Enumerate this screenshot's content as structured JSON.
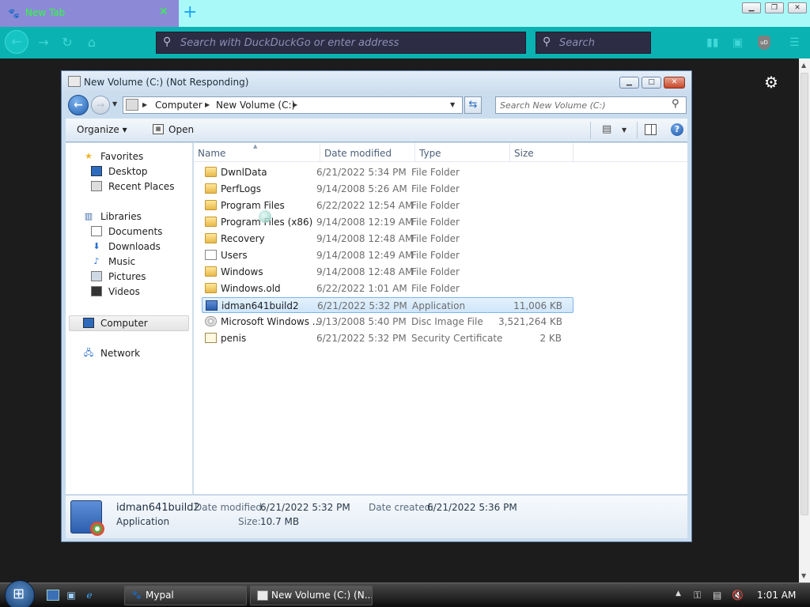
{
  "browser": {
    "tab_title": "New Tab",
    "tab_close": "✕",
    "new_tab": "+",
    "url_placeholder": "Search with DuckDuckGo or enter address",
    "search_placeholder": "Search",
    "ublock_label": "uD"
  },
  "explorer": {
    "title": "New Volume (C:) (Not Responding)",
    "breadcrumbs": [
      "Computer",
      "New Volume (C:)"
    ],
    "search_placeholder": "Search New Volume (C:)",
    "toolbar": {
      "organize": "Organize ▾",
      "open": "Open"
    },
    "nav": {
      "favorites": "Favorites",
      "desktop": "Desktop",
      "recent_places": "Recent Places",
      "libraries": "Libraries",
      "documents": "Documents",
      "downloads": "Downloads",
      "music": "Music",
      "pictures": "Pictures",
      "videos": "Videos",
      "computer": "Computer",
      "network": "Network"
    },
    "columns": {
      "name": "Name",
      "date": "Date modified",
      "type": "Type",
      "size": "Size"
    },
    "files": [
      {
        "name": "DwnlData",
        "date": "6/21/2022 5:34 PM",
        "type": "File Folder",
        "size": "",
        "icon": "folder-icon"
      },
      {
        "name": "PerfLogs",
        "date": "9/14/2008 5:26 AM",
        "type": "File Folder",
        "size": "",
        "icon": "folder-icon"
      },
      {
        "name": "Program Files",
        "date": "6/22/2022 12:54 AM",
        "type": "File Folder",
        "size": "",
        "icon": "folder-icon"
      },
      {
        "name": "Program Files (x86)",
        "date": "9/14/2008 12:19 AM",
        "type": "File Folder",
        "size": "",
        "icon": "folder-icon"
      },
      {
        "name": "Recovery",
        "date": "9/14/2008 12:48 AM",
        "type": "File Folder",
        "size": "",
        "icon": "folder-icon"
      },
      {
        "name": "Users",
        "date": "9/14/2008 12:49 AM",
        "type": "File Folder",
        "size": "",
        "icon": "users-folder-icon"
      },
      {
        "name": "Windows",
        "date": "9/14/2008 12:48 AM",
        "type": "File Folder",
        "size": "",
        "icon": "folder-icon"
      },
      {
        "name": "Windows.old",
        "date": "6/22/2022 1:01 AM",
        "type": "File Folder",
        "size": "",
        "icon": "folder-icon"
      },
      {
        "name": "idman641build2",
        "date": "6/21/2022 5:32 PM",
        "type": "Application",
        "size": "11,006 KB",
        "icon": "application-icon"
      },
      {
        "name": "Microsoft Windows ...",
        "date": "9/13/2008 5:40 PM",
        "type": "Disc Image File",
        "size": "3,521,264 KB",
        "icon": "disc-image-icon"
      },
      {
        "name": "penis",
        "date": "6/21/2022 5:32 PM",
        "type": "Security Certificate",
        "size": "2 KB",
        "icon": "certificate-icon"
      }
    ],
    "selected_index": 8,
    "details": {
      "name": "idman641build2",
      "type": "Application",
      "date_modified_label": "Date modified:",
      "date_modified": "6/21/2022 5:32 PM",
      "size_label": "Size:",
      "size": "10.7 MB",
      "date_created_label": "Date created:",
      "date_created": "6/21/2022 5:36 PM"
    }
  },
  "taskbar": {
    "items": [
      "Mypal",
      "New Volume (C:) (N..."
    ],
    "clock": "1:01 AM"
  },
  "colors": {
    "tab_active": "#8c8ad6",
    "tabbar": "#aaf9f9",
    "navbar": "#0bb2b2",
    "tab_text": "#2cff40",
    "page_bg": "#1c1c1c",
    "selection": "#cfe6fa"
  }
}
